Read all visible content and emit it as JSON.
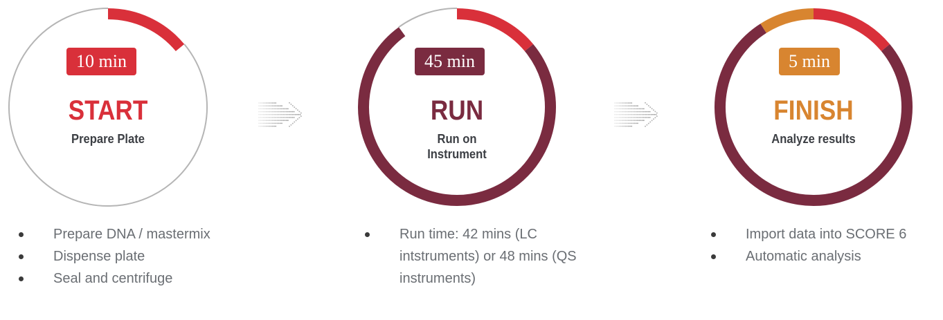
{
  "colors": {
    "red": "#d9303a",
    "maroon": "#7a2b40",
    "orange": "#d88530",
    "gray": "#b5b5b5",
    "dark_text": "#3c3f44",
    "bullet_text": "#6a6e73"
  },
  "steps": [
    {
      "time_label": "10 min",
      "title": "START",
      "subtitle": "Prepare Plate",
      "bullets": [
        "Prepare DNA / mastermix",
        "Dispense plate",
        "Seal and centrifuge"
      ],
      "ring": {
        "segments": [
          {
            "from": 0.0,
            "to": 0.14,
            "color": "red"
          },
          {
            "from": 0.14,
            "to": 1.0,
            "color": "gray"
          }
        ]
      }
    },
    {
      "time_label": "45 min",
      "title": "RUN",
      "subtitle": "Run on Instrument",
      "bullets": [
        "Run time: 42 mins (LC intstruments) or 48 mins (QS instruments)"
      ],
      "ring": {
        "segments": [
          {
            "from": 0.0,
            "to": 0.14,
            "color": "red"
          },
          {
            "from": 0.14,
            "to": 0.9,
            "color": "maroon"
          },
          {
            "from": 0.9,
            "to": 1.0,
            "color": "gray"
          }
        ]
      }
    },
    {
      "time_label": "5 min",
      "title": "FINISH",
      "subtitle": "Analyze results",
      "bullets": [
        "Import data into SCORE 6",
        "Automatic analysis"
      ],
      "ring": {
        "segments": [
          {
            "from": 0.0,
            "to": 0.14,
            "color": "red"
          },
          {
            "from": 0.14,
            "to": 0.91,
            "color": "maroon"
          },
          {
            "from": 0.91,
            "to": 1.0,
            "color": "orange"
          }
        ]
      }
    }
  ]
}
